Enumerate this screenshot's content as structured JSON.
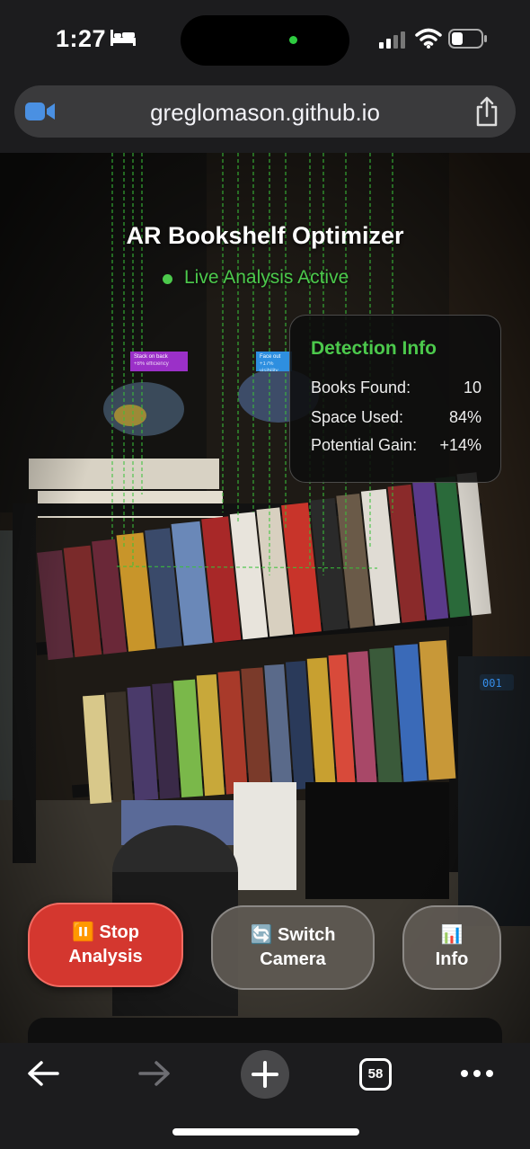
{
  "status_bar": {
    "time": "1:27"
  },
  "browser": {
    "url": "greglomason.github.io",
    "tab_count": "58"
  },
  "app": {
    "title": "AR Bookshelf Optimizer",
    "live_status": "Live Analysis Active",
    "detection_info": {
      "title": "Detection Info",
      "rows": [
        {
          "label": "Books Found:",
          "value": "10"
        },
        {
          "label": "Space Used:",
          "value": "84%"
        },
        {
          "label": "Potential Gain:",
          "value": "+14%"
        }
      ]
    },
    "suggestion_tags": [
      {
        "title": "Stack on back",
        "detail": "+8% efficiency",
        "color": "#9b30c8"
      },
      {
        "title": "Face out",
        "detail": "+17% visibility",
        "color": "#2e8fe0"
      }
    ],
    "buttons": {
      "stop": {
        "icon": "⏸️",
        "line1": "Stop",
        "line2": "Analysis"
      },
      "switch": {
        "icon": "🔄",
        "line1": "Switch",
        "line2": "Camera"
      },
      "info": {
        "icon": "📊",
        "line1": "",
        "line2": "Info"
      }
    }
  },
  "colors": {
    "accent_green": "#4cc94c",
    "stop_red": "#d4372f",
    "toolbar_bg": "#1c1c1e"
  }
}
